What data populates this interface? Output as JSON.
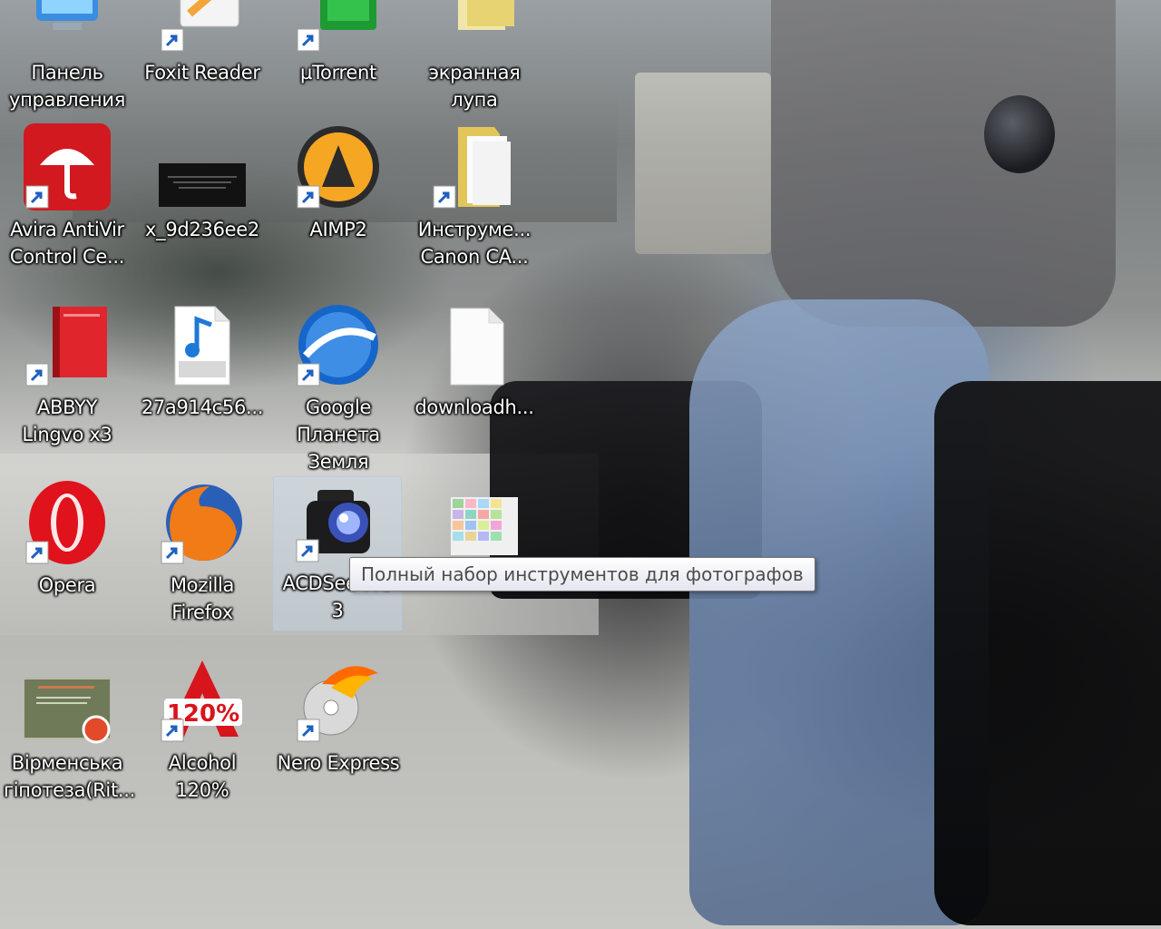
{
  "desktop": {
    "icons": [
      {
        "label": "Панель\nуправления",
        "icon": "control-panel-icon",
        "shortcut": false
      },
      {
        "label": "Foxit Reader",
        "icon": "foxit-reader-icon",
        "shortcut": true
      },
      {
        "label": "µTorrent",
        "icon": "utorrent-icon",
        "shortcut": true
      },
      {
        "label": "экранная\nлупа",
        "icon": "magnifier-icon",
        "shortcut": false
      },
      {
        "label": "Avira AntiVir\nControl Ce...",
        "icon": "avira-icon",
        "shortcut": true
      },
      {
        "label": "x_9d236ee2",
        "icon": "image-file-icon",
        "shortcut": false
      },
      {
        "label": "AIMP2",
        "icon": "aimp-icon",
        "shortcut": true
      },
      {
        "label": "Инструме...\nCanon CA...",
        "icon": "folder-icon",
        "shortcut": true
      },
      {
        "label": "ABBYY\nLingvo x3",
        "icon": "abbyy-lingvo-icon",
        "shortcut": true
      },
      {
        "label": "27a914c56...",
        "icon": "mp3-file-icon",
        "shortcut": false
      },
      {
        "label": "Google\nПланета\nЗемля",
        "icon": "google-earth-icon",
        "shortcut": true
      },
      {
        "label": "downloadh...",
        "icon": "blank-file-icon",
        "shortcut": false
      },
      {
        "label": "Opera",
        "icon": "opera-icon",
        "shortcut": true
      },
      {
        "label": "Mozilla\nFirefox",
        "icon": "firefox-icon",
        "shortcut": true
      },
      {
        "label": "ACDSee Pro\n3",
        "icon": "acdsee-camera-icon",
        "shortcut": true,
        "selected": true
      },
      {
        "label": "",
        "icon": "spreadsheet-image-icon",
        "shortcut": false
      },
      {
        "label": "Вірменська\nгіпотеза(Rit...",
        "icon": "presentation-file-icon",
        "shortcut": false
      },
      {
        "label": "Alcohol\n120%",
        "icon": "alcohol-120-icon",
        "shortcut": true
      },
      {
        "label": "Nero Express",
        "icon": "nero-express-icon",
        "shortcut": true
      }
    ]
  },
  "tooltip": {
    "text": "Полный набор инструментов для фотографов"
  },
  "colors": {
    "label_text": "#ffffff",
    "selection_fill": "#c8dcf0",
    "tooltip_text": "#4c4c4c",
    "shortcut_arrow": "#1f5fbf"
  }
}
